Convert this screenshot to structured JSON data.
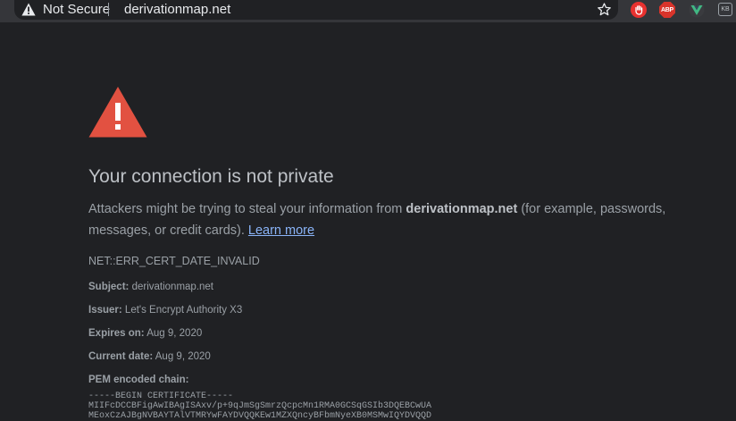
{
  "browser": {
    "security_label": "Not Secure",
    "url": "derivationmap.net",
    "extensions": {
      "abp_label": "ABP",
      "kb_label": "KB"
    }
  },
  "error_page": {
    "title": "Your connection is not private",
    "description_prefix": "Attackers might be trying to steal your information from ",
    "domain": "derivationmap.net",
    "description_suffix": " (for example, passwords, messages, or credit cards). ",
    "learn_more": "Learn more",
    "error_code": "NET::ERR_CERT_DATE_INVALID",
    "details": [
      {
        "key": "Subject:",
        "value": "derivationmap.net"
      },
      {
        "key": "Issuer:",
        "value": "Let's Encrypt Authority X3"
      },
      {
        "key": "Expires on:",
        "value": "Aug 9, 2020"
      },
      {
        "key": "Current date:",
        "value": "Aug 9, 2020"
      },
      {
        "key": "PEM encoded chain:",
        "value": ""
      }
    ],
    "pem_lines": [
      "-----BEGIN CERTIFICATE-----",
      "MIIFcDCCBFigAwIBAgISAxv/p+9qJmSgSmrzQcpcMn1RMA0GCSqGSIb3DQEBCwUA",
      "MEoxCzAJBgNVBAYTAlVTMRYwFAYDVQQKEw1MZXQncyBFbmNyeXB0MSMwIQYDVQQD"
    ]
  },
  "colors": {
    "page_bg": "#202124",
    "toolbar_bg": "#35363a",
    "warning_red": "#e25141",
    "link": "#8ab4f8"
  }
}
